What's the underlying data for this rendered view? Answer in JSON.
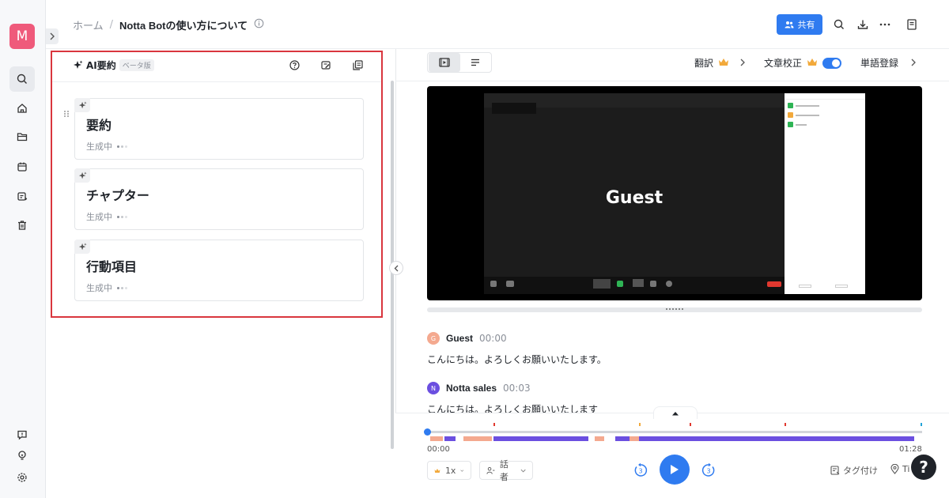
{
  "rail": {
    "avatar_letter": "M",
    "items": [
      "search",
      "home",
      "folder",
      "calendar",
      "schedule",
      "trash"
    ],
    "bottom_items": [
      "feedback",
      "idea",
      "settings"
    ]
  },
  "header": {
    "breadcrumb_home": "ホーム",
    "breadcrumb_sep": "/",
    "breadcrumb_title": "Notta Botの使い方について",
    "share_label": "共有"
  },
  "summary_panel": {
    "title": "AI要約",
    "beta": "ベータ版",
    "cards": [
      {
        "title": "要約",
        "status": "生成中"
      },
      {
        "title": "チャプター",
        "status": "生成中"
      },
      {
        "title": "行動項目",
        "status": "生成中"
      }
    ]
  },
  "toolbar": {
    "translate_label": "翻訳",
    "proofread_label": "文章校正",
    "proofread_on": true,
    "glossary_label": "単語登録"
  },
  "video": {
    "speaker_label": "Guest"
  },
  "transcript": [
    {
      "initial": "G",
      "speaker": "Guest",
      "time": "00:00",
      "text": "こんにちは。よろしくお願いいたします。",
      "color": "#f4a98f"
    },
    {
      "initial": "N",
      "speaker": "Notta sales",
      "time": "00:03",
      "text": "こんにちは。よろしくお願いいたします",
      "color": "#6b4fe0"
    }
  ],
  "player": {
    "current_time": "00:00",
    "total_time": "01:28",
    "speed": "1x",
    "speaker_filter": "話者",
    "tag_label": "タグ付け",
    "timestamp_label": "Ti",
    "skip_seconds": "3",
    "help": "?"
  },
  "colors": {
    "accent": "#2f7bf0",
    "guest": "#f4a98f",
    "sales": "#6b4fe0",
    "highlight_border": "#d9363e"
  }
}
